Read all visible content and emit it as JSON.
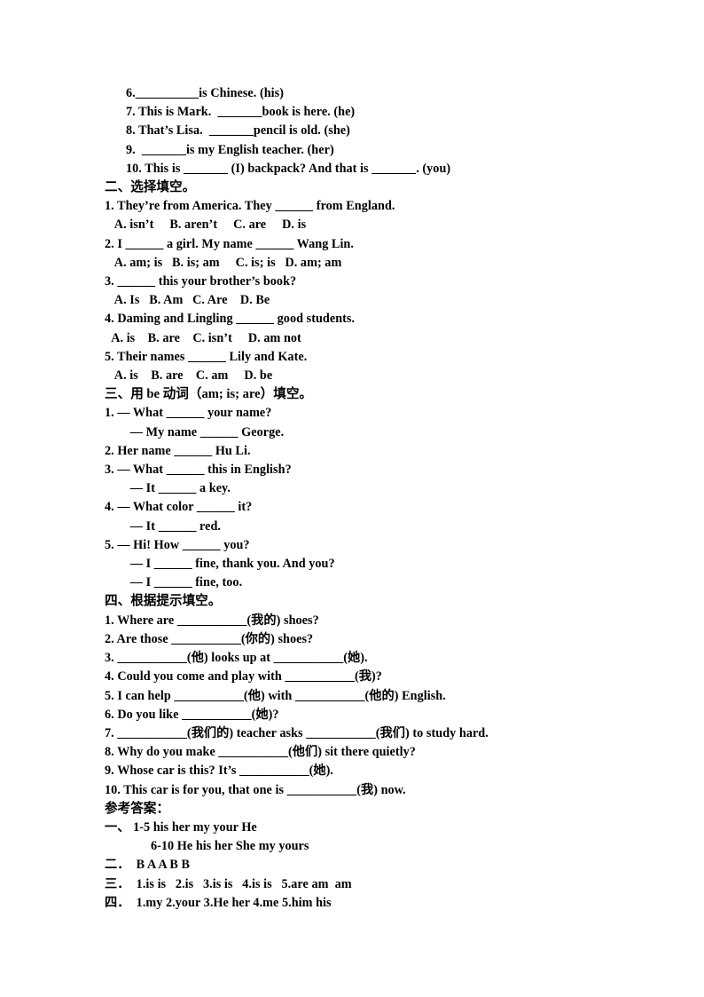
{
  "document": {
    "type": "worksheet",
    "language": "zh-CN/en",
    "background_color": "#ffffff",
    "text_color": "#000000"
  },
  "section_one_tail": {
    "items": [
      "6.__________is Chinese. (his)",
      "7. This is Mark.  _______book is here. (he)",
      "8. That’s Lisa.  _______pencil is old. (she)",
      "9.  _______is my English teacher. (her)",
      "10. This is _______ (I) backpack? And that is _______. (you)"
    ]
  },
  "section_two": {
    "heading": "二、选择填空。",
    "items": [
      {
        "stem": "1. They’re from America. They ______ from England.",
        "options": "   A. isn’t     B. aren’t     C. are     D. is"
      },
      {
        "stem": "2. I ______ a girl. My name ______ Wang Lin.",
        "options": "   A. am; is   B. is; am     C. is; is   D. am; am"
      },
      {
        "stem": "3. ______ this your brother’s book?",
        "options": "   A. Is   B. Am   C. Are    D. Be"
      },
      {
        "stem": "4. Daming and Lingling ______ good students.",
        "options": "  A. is    B. are    C. isn’t     D. am not"
      },
      {
        "stem": "5. Their names ______ Lily and Kate.",
        "options": "   A. is    B. are    C. am     D. be"
      }
    ]
  },
  "section_three": {
    "heading": "三、用 be 动词（am; is; are）填空。",
    "items": [
      "1. — What ______ your name?",
      "   — My name ______ George.",
      "2. Her name ______ Hu Li.",
      "3. — What ______ this in English?",
      "   — It ______ a key.",
      "4. — What color ______ it?",
      "   — It ______ red.",
      "5. — Hi! How ______ you?",
      "   — I ______ fine, thank you. And you?",
      "   — I ______ fine, too."
    ],
    "sub_indent_lines": [
      1,
      4,
      6,
      8,
      9
    ]
  },
  "section_four": {
    "heading": "四、根据提示填空。",
    "items": [
      "1. Where are ___________(我的) shoes?",
      "2. Are those ___________(你的) shoes?",
      "3. ___________(他) looks up at ___________(她).",
      "4. Could you come and play with ___________(我)?",
      "5. I can help ___________(他) with ___________(他的) English.",
      "6. Do you like ___________(她)?",
      "7. ___________(我们的) teacher asks ___________(我们) to study hard.",
      "8. Why do you make ___________(他们) sit there quietly?",
      "9. Whose car is this? It’s ___________(她).",
      "10. This car is for you, that one is ___________(我) now."
    ]
  },
  "answers": {
    "heading": "参考答案：",
    "lines": [
      "一、 1-5 his her my your He",
      "     6-10 He his her She my yours",
      "二．  B A A B B",
      "三．  1.is is   2.is   3.is is   4.is is   5.are am  am",
      "四．  1.my 2.your 3.He her 4.me 5.him his"
    ]
  }
}
